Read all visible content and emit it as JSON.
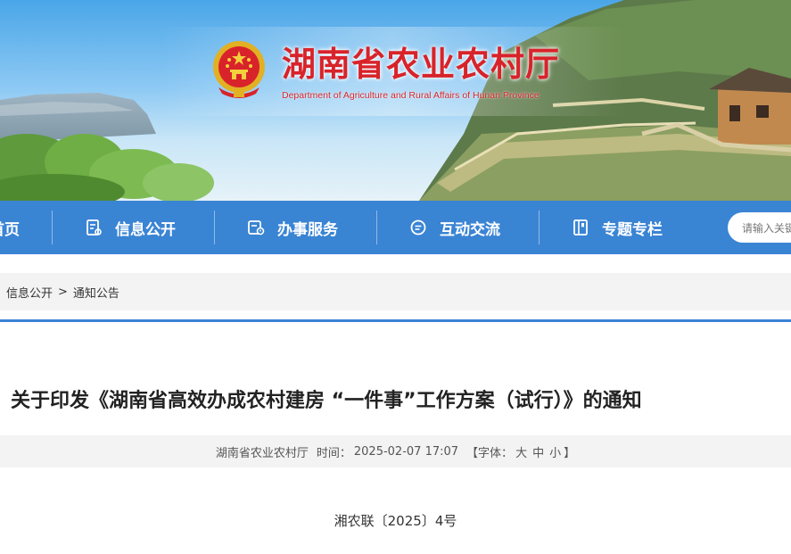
{
  "site": {
    "title_cn": "湖南省农业农村厅",
    "title_en": "Department of Agriculture and Rural Affairs of Hunan Province"
  },
  "nav": {
    "items": [
      {
        "label": "首页",
        "icon": "home-icon"
      },
      {
        "label": "信息公开",
        "icon": "document-icon"
      },
      {
        "label": "办事服务",
        "icon": "service-icon"
      },
      {
        "label": "互动交流",
        "icon": "chat-icon"
      },
      {
        "label": "专题专栏",
        "icon": "bookmark-icon"
      }
    ],
    "search_placeholder": "请输入关键词"
  },
  "breadcrumb": {
    "items": [
      "信息公开",
      "通知公告"
    ],
    "separator": ">"
  },
  "article": {
    "title": "关于印发《湖南省高效办成农村建房 “一件事”工作方案（试行）》的通知",
    "source": "湖南省农业农村厅",
    "time_label": "时间：",
    "time": "2025-02-07 17:07",
    "font_size_label": "【字体：",
    "font_large": "大",
    "font_medium": "中",
    "font_small": "小",
    "font_close": "】",
    "doc_number": "湘农联〔2025〕4号"
  },
  "colors": {
    "nav_blue": "#3a84d4",
    "title_red": "#d8232a",
    "meta_bg": "#f3f3f3"
  }
}
